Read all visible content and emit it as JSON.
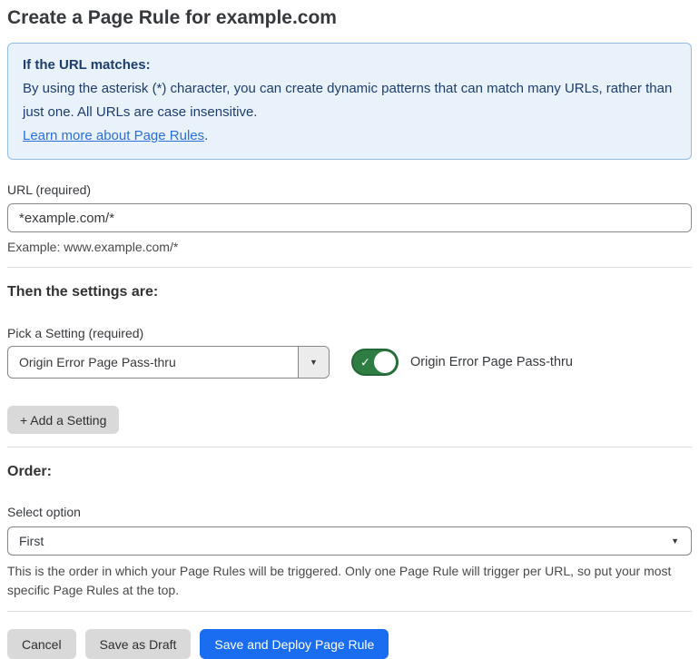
{
  "page": {
    "title": "Create a Page Rule for example.com"
  },
  "info_box": {
    "heading": "If the URL matches:",
    "body": "By using the asterisk (*) character, you can create dynamic patterns that can match many URLs, rather than just one. All URLs are case insensitive.",
    "link_label": "Learn more about Page Rules",
    "link_suffix": "."
  },
  "url_field": {
    "label": "URL (required)",
    "value": "*example.com/*",
    "example": "Example: www.example.com/*"
  },
  "settings_section": {
    "heading": "Then the settings are:",
    "picker_label": "Pick a Setting (required)",
    "picker_value": "Origin Error Page Pass-thru",
    "toggle_state": "on",
    "toggle_check_icon": "✓",
    "toggle_label": "Origin Error Page Pass-thru",
    "add_setting_label": "+ Add a Setting",
    "dropdown_arrow_icon": "▼"
  },
  "order_section": {
    "heading": "Order:",
    "select_label": "Select option",
    "select_value": "First",
    "dropdown_arrow_icon": "▼",
    "help_text": "This is the order in which your Page Rules will be triggered. Only one Page Rule will trigger per URL, so put your most specific Page Rules at the top."
  },
  "footer": {
    "cancel_label": "Cancel",
    "save_draft_label": "Save as Draft",
    "save_deploy_label": "Save and Deploy Page Rule"
  },
  "colors": {
    "info_box_bg": "#e9f2fb",
    "info_box_border": "#93bce6",
    "info_box_text": "#1d3d6e",
    "link_blue": "#2b6ee0",
    "primary_button_blue": "#1a6cf0",
    "toggle_on_green": "#2e7d43",
    "gray_button_bg": "#d9d9d9"
  }
}
